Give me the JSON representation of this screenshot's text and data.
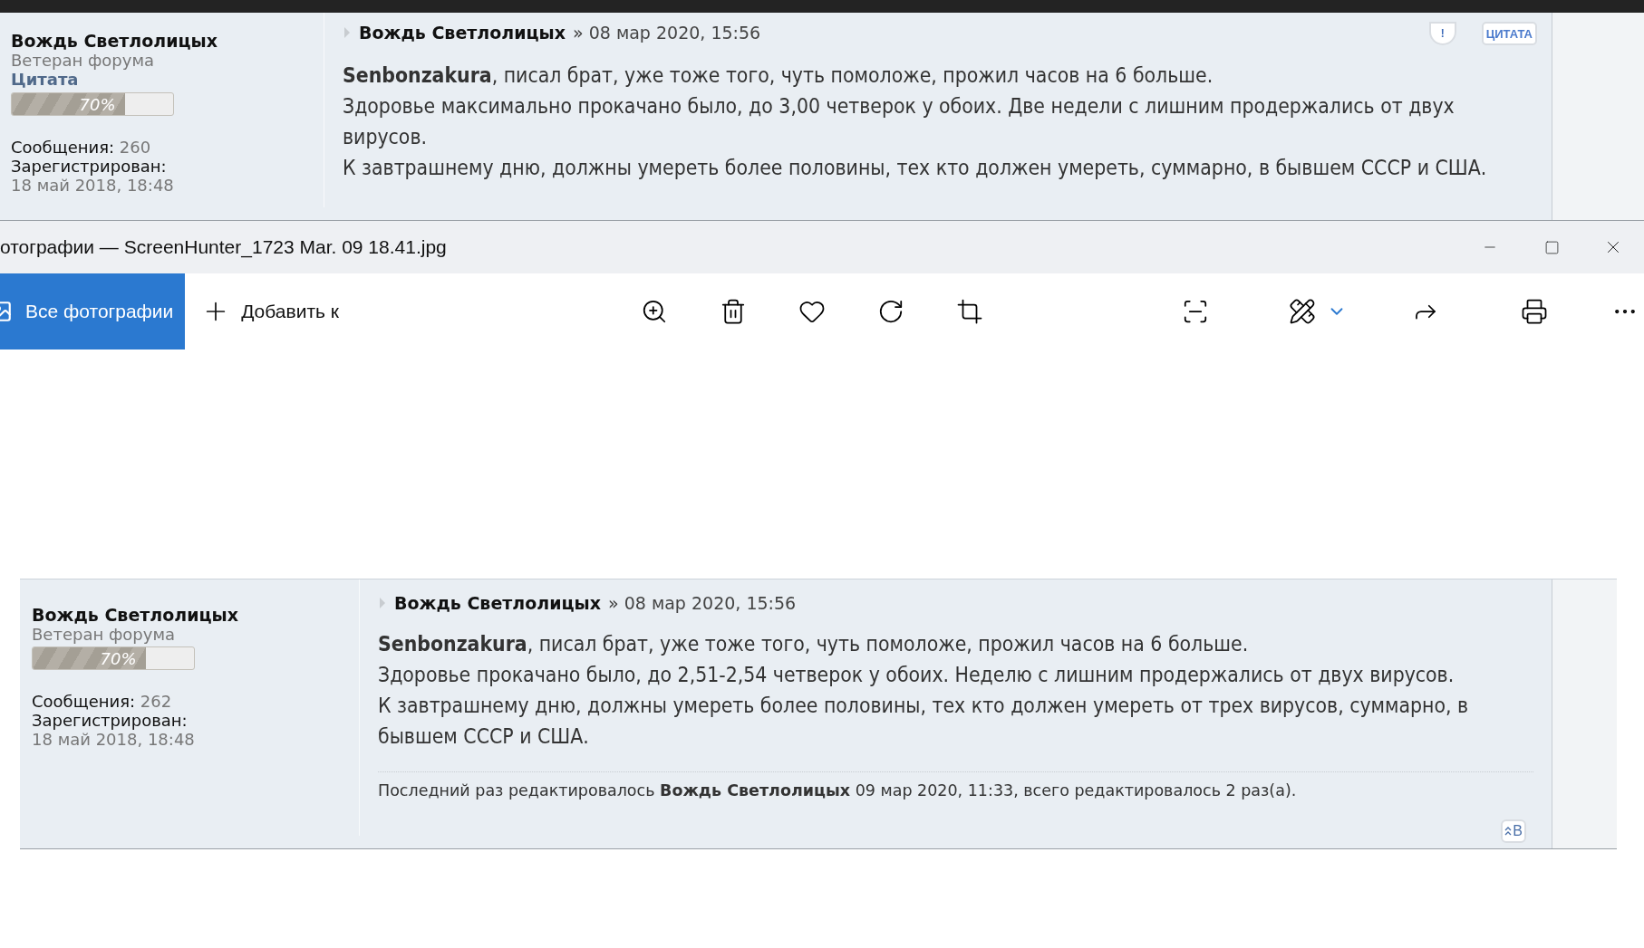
{
  "posts": [
    {
      "author": "Вождь Светлолицых",
      "rank": "Ветеран форума",
      "rank_title": "Цитата",
      "reputation": {
        "label": "70%",
        "level": 0.7
      },
      "stats": [
        {
          "label": "Сообщения:",
          "value": "260"
        },
        {
          "label": "Зарегистрирован:",
          "value": "18 май 2018, 18:48"
        }
      ],
      "header": {
        "author": "Вождь Светлолицых",
        "date": "» 08 мар 2020, 15:56"
      },
      "report": "!",
      "quote_button": "ЦИТАТА",
      "paragraphs": [
        "**Senbonzakura**, писал брат, уже тоже того, чуть помоложе, прожил часов на 6 больше.",
        "Здоровье максимально прокачано было, до 3,00 четверок у обоих. Две недели с лишним продержались от двух вирусов.",
        "К завтрашнему дню, должны умереть более половины, тех кто должен умереть, суммарно, в бывшем СССР и США."
      ]
    },
    {
      "author": "Вождь Светлолицых",
      "rank": "Ветеран форума",
      "reputation": {
        "label": "70%",
        "level": 0.7
      },
      "stats": [
        {
          "label": "Сообщения:",
          "value": "262"
        },
        {
          "label": "Зарегистрирован:",
          "value": "18 май 2018, 18:48"
        }
      ],
      "header": {
        "author": "Вождь Светлолицых",
        "date": "» 08 мар 2020, 15:56"
      },
      "paragraphs": [
        "**Senbonzakura**, писал брат, уже тоже того, чуть помоложе, прожил часов на 6 больше.",
        "Здоровье прокачано было, до 2,51-2,54 четверок у обоих. Неделю с лишним продержались от двух вирусов.",
        "К завтрашнему дню, должны умереть более половины, тех кто должен умереть от трех вирусов, суммарно, в бывшем СССР и США."
      ],
      "edit_note": "Последний раз редактировалось **Вождь Светлолицых** 09 мар 2020, 11:33, всего редактировалось 2 раз(а).",
      "top_link": "В"
    }
  ],
  "viewer": {
    "title": "отографии — ScreenHunter_1723 Mar. 09 18.41.jpg",
    "all_photos": "Все фотографии",
    "add_to": "Добавить к"
  }
}
